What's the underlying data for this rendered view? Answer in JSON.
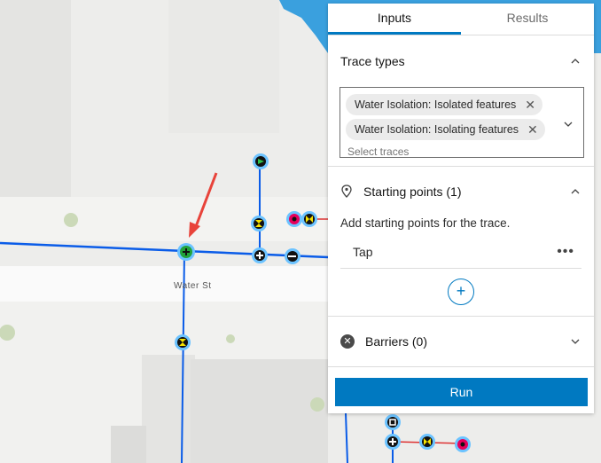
{
  "map": {
    "street_label": "Water St"
  },
  "tabs": [
    {
      "label": "Inputs",
      "active": true
    },
    {
      "label": "Results",
      "active": false
    }
  ],
  "trace_types": {
    "title": "Trace types",
    "selected": [
      "Water Isolation: Isolated features",
      "Water Isolation: Isolating features"
    ],
    "placeholder": "Select traces"
  },
  "starting_points": {
    "title": "Starting points (1)",
    "hint": "Add starting points for the trace.",
    "items": [
      {
        "label": "Tap",
        "menu": "•••"
      }
    ],
    "add_label": "+"
  },
  "barriers": {
    "title": "Barriers (0)"
  },
  "run_label": "Run",
  "colors": {
    "accent": "#0079c1",
    "pipe": "#0a5ce8",
    "water": "#1f8fe0",
    "arrow": "#e8433a",
    "starting_point": "#21a33a"
  }
}
